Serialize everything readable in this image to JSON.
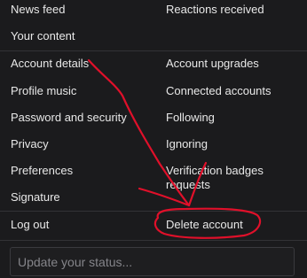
{
  "menu": {
    "left": [
      {
        "label": "News feed"
      },
      {
        "label": "Your content"
      },
      {
        "label": "Account details"
      },
      {
        "label": "Profile music"
      },
      {
        "label": "Password and security"
      },
      {
        "label": "Privacy"
      },
      {
        "label": "Preferences"
      },
      {
        "label": "Signature"
      },
      {
        "label": "Log out"
      }
    ],
    "right": [
      {
        "label": "Reactions received"
      },
      {
        "label": "Account upgrades"
      },
      {
        "label": "Connected accounts"
      },
      {
        "label": "Following"
      },
      {
        "label": "Ignoring"
      },
      {
        "label": "Verification badges requests"
      },
      {
        "label": "Delete account"
      }
    ]
  },
  "status": {
    "placeholder": "Update your status..."
  },
  "colors": {
    "background": "#1b1b1d",
    "text": "#e8e8e8",
    "annotation": "#e0102a"
  }
}
